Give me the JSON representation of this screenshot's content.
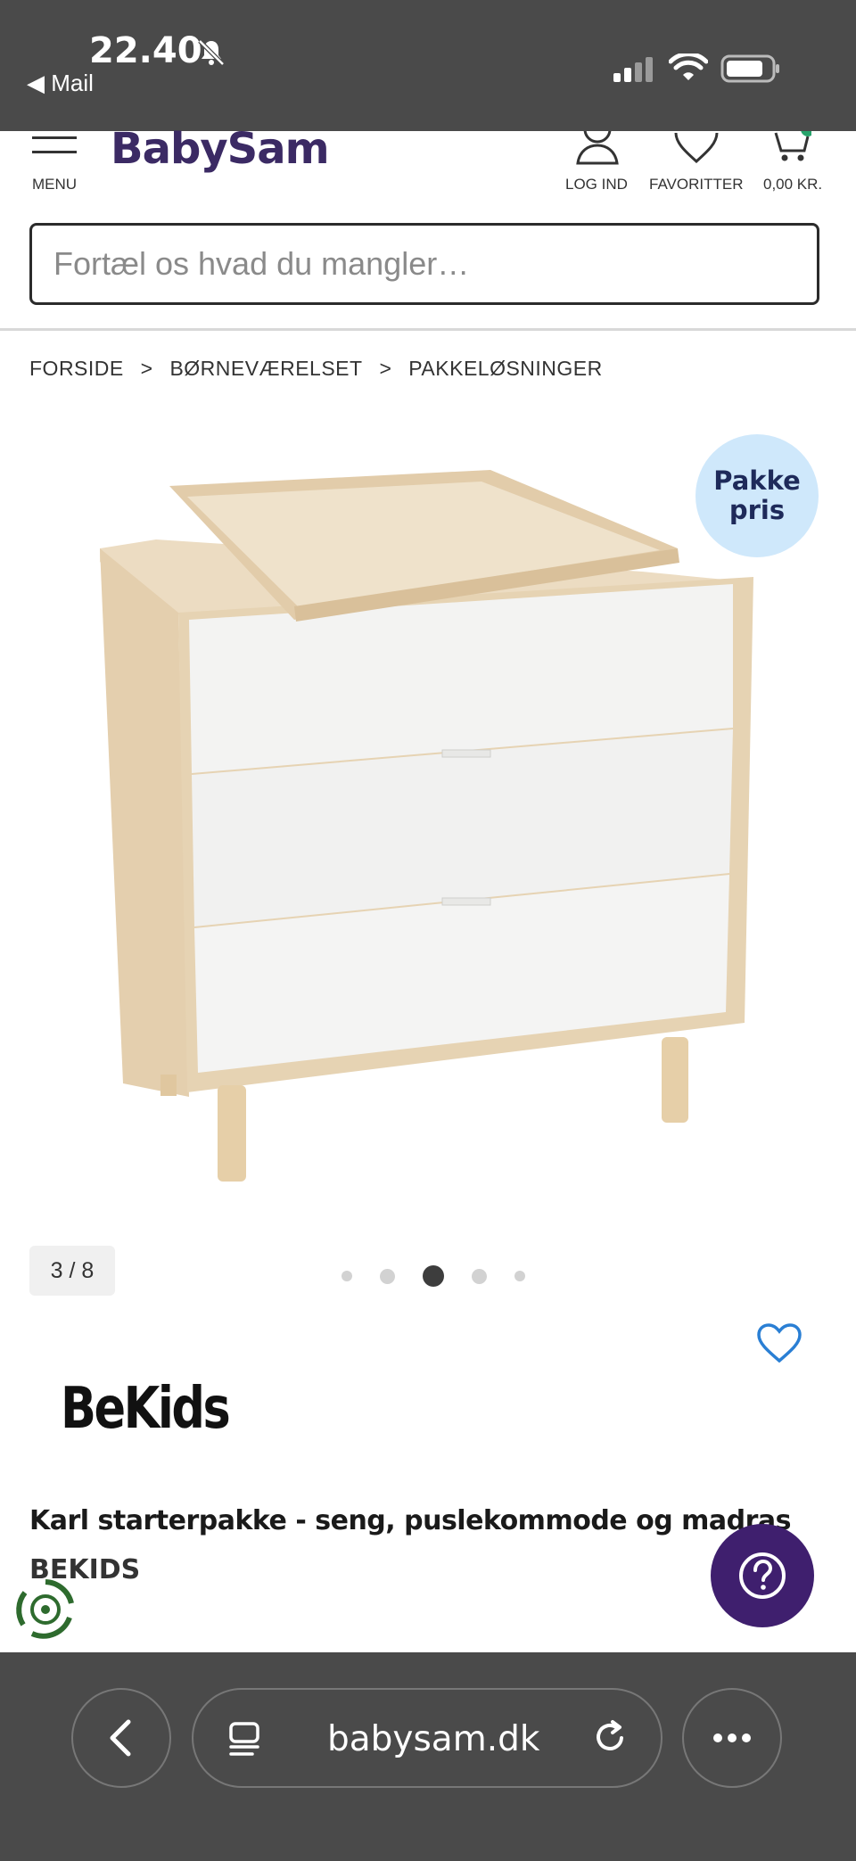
{
  "status_bar": {
    "time": "22.40",
    "back_app": "◀ Mail"
  },
  "header": {
    "menu_label": "MENU",
    "logo": "BabySam",
    "login_label": "LOG IND",
    "favorites_label": "FAVORITTER",
    "cart_label": "0,00 KR."
  },
  "search": {
    "placeholder": "Fortæl os hvad du mangler…"
  },
  "breadcrumb": {
    "items": [
      "FORSIDE",
      ">",
      "BØRNEVÆRELSET",
      ">",
      "PAKKELØSNINGER"
    ]
  },
  "product": {
    "badge_line1": "Pakke",
    "badge_line2": "pris",
    "image_counter": "3 / 8",
    "carousel": {
      "total_dots": 5,
      "active_dot": 3
    },
    "brand_logo": "BeKids",
    "title": "Karl starterpakke - seng, puslekommode og madras",
    "brand": "BEKIDS"
  },
  "browser": {
    "url": "babysam.dk"
  },
  "colors": {
    "brand_purple": "#3b2a64",
    "help_button": "#3f1f6e",
    "badge_bg": "#cfe8fb",
    "heart_blue": "#2a7fd4",
    "chrome_bg": "#4a4a4a"
  }
}
